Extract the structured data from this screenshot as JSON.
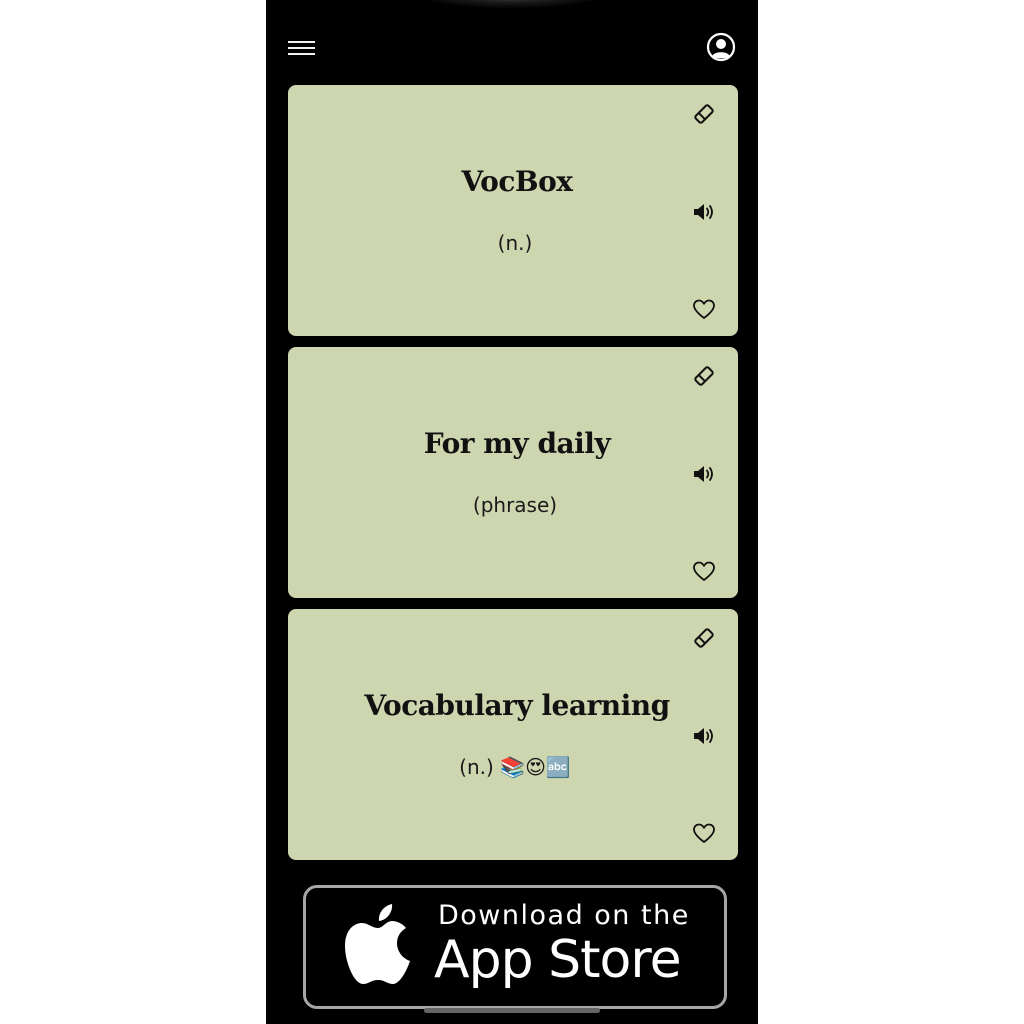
{
  "header": {
    "menu_icon": "hamburger-menu-icon",
    "profile_icon": "user-circle-icon"
  },
  "cards": [
    {
      "title": "VocBox",
      "part_of_speech": "(n.)",
      "icons": [
        "eraser-icon",
        "speaker-icon",
        "heart-icon"
      ]
    },
    {
      "title": "For my daily",
      "part_of_speech": "(phrase)",
      "icons": [
        "eraser-icon",
        "speaker-icon",
        "heart-icon"
      ]
    },
    {
      "title": "Vocabulary learning",
      "part_of_speech": "(n.) 📚😍🔤",
      "icons": [
        "eraser-icon",
        "speaker-icon",
        "heart-icon"
      ]
    }
  ],
  "app_store_badge": {
    "line1": "Download on the",
    "line2": "App Store",
    "icon": "apple-logo-icon"
  },
  "colors": {
    "background": "#000000",
    "card": "#cdd6ae",
    "text": "#111111"
  }
}
